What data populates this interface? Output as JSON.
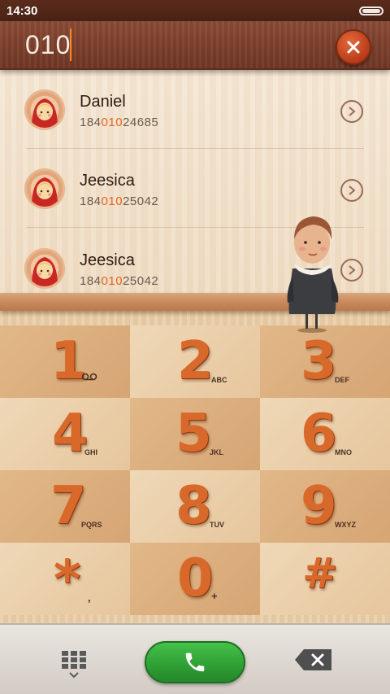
{
  "status": {
    "time": "14:30"
  },
  "input": {
    "digits": "010"
  },
  "results": [
    {
      "name": "Daniel",
      "number_pre": "184",
      "number_match": "010",
      "number_post": "24685"
    },
    {
      "name": "Jeesica",
      "number_pre": "184",
      "number_match": "010",
      "number_post": "25042"
    },
    {
      "name": "Jeesica",
      "number_pre": "184",
      "number_match": "010",
      "number_post": "25042"
    }
  ],
  "keypad": [
    {
      "digit": "1",
      "letters": ""
    },
    {
      "digit": "2",
      "letters": "ABC"
    },
    {
      "digit": "3",
      "letters": "DEF"
    },
    {
      "digit": "4",
      "letters": "GHI"
    },
    {
      "digit": "5",
      "letters": "JKL"
    },
    {
      "digit": "6",
      "letters": "MNO"
    },
    {
      "digit": "7",
      "letters": "PQRS"
    },
    {
      "digit": "8",
      "letters": "TUV"
    },
    {
      "digit": "9",
      "letters": "WXYZ"
    },
    {
      "digit": "*",
      "letters": ","
    },
    {
      "digit": "0",
      "letters": "+"
    },
    {
      "digit": "#",
      "letters": ""
    }
  ],
  "colors": {
    "accent": "#e0651e",
    "call": "#2e9e34",
    "keypad_digit": "#d8692b"
  },
  "icons": {
    "clear": "close-icon",
    "details": "chevron-right-icon",
    "voicemail": "voicemail-icon",
    "keypad_toggle": "dialpad-icon",
    "call": "phone-icon",
    "backspace": "backspace-icon"
  }
}
